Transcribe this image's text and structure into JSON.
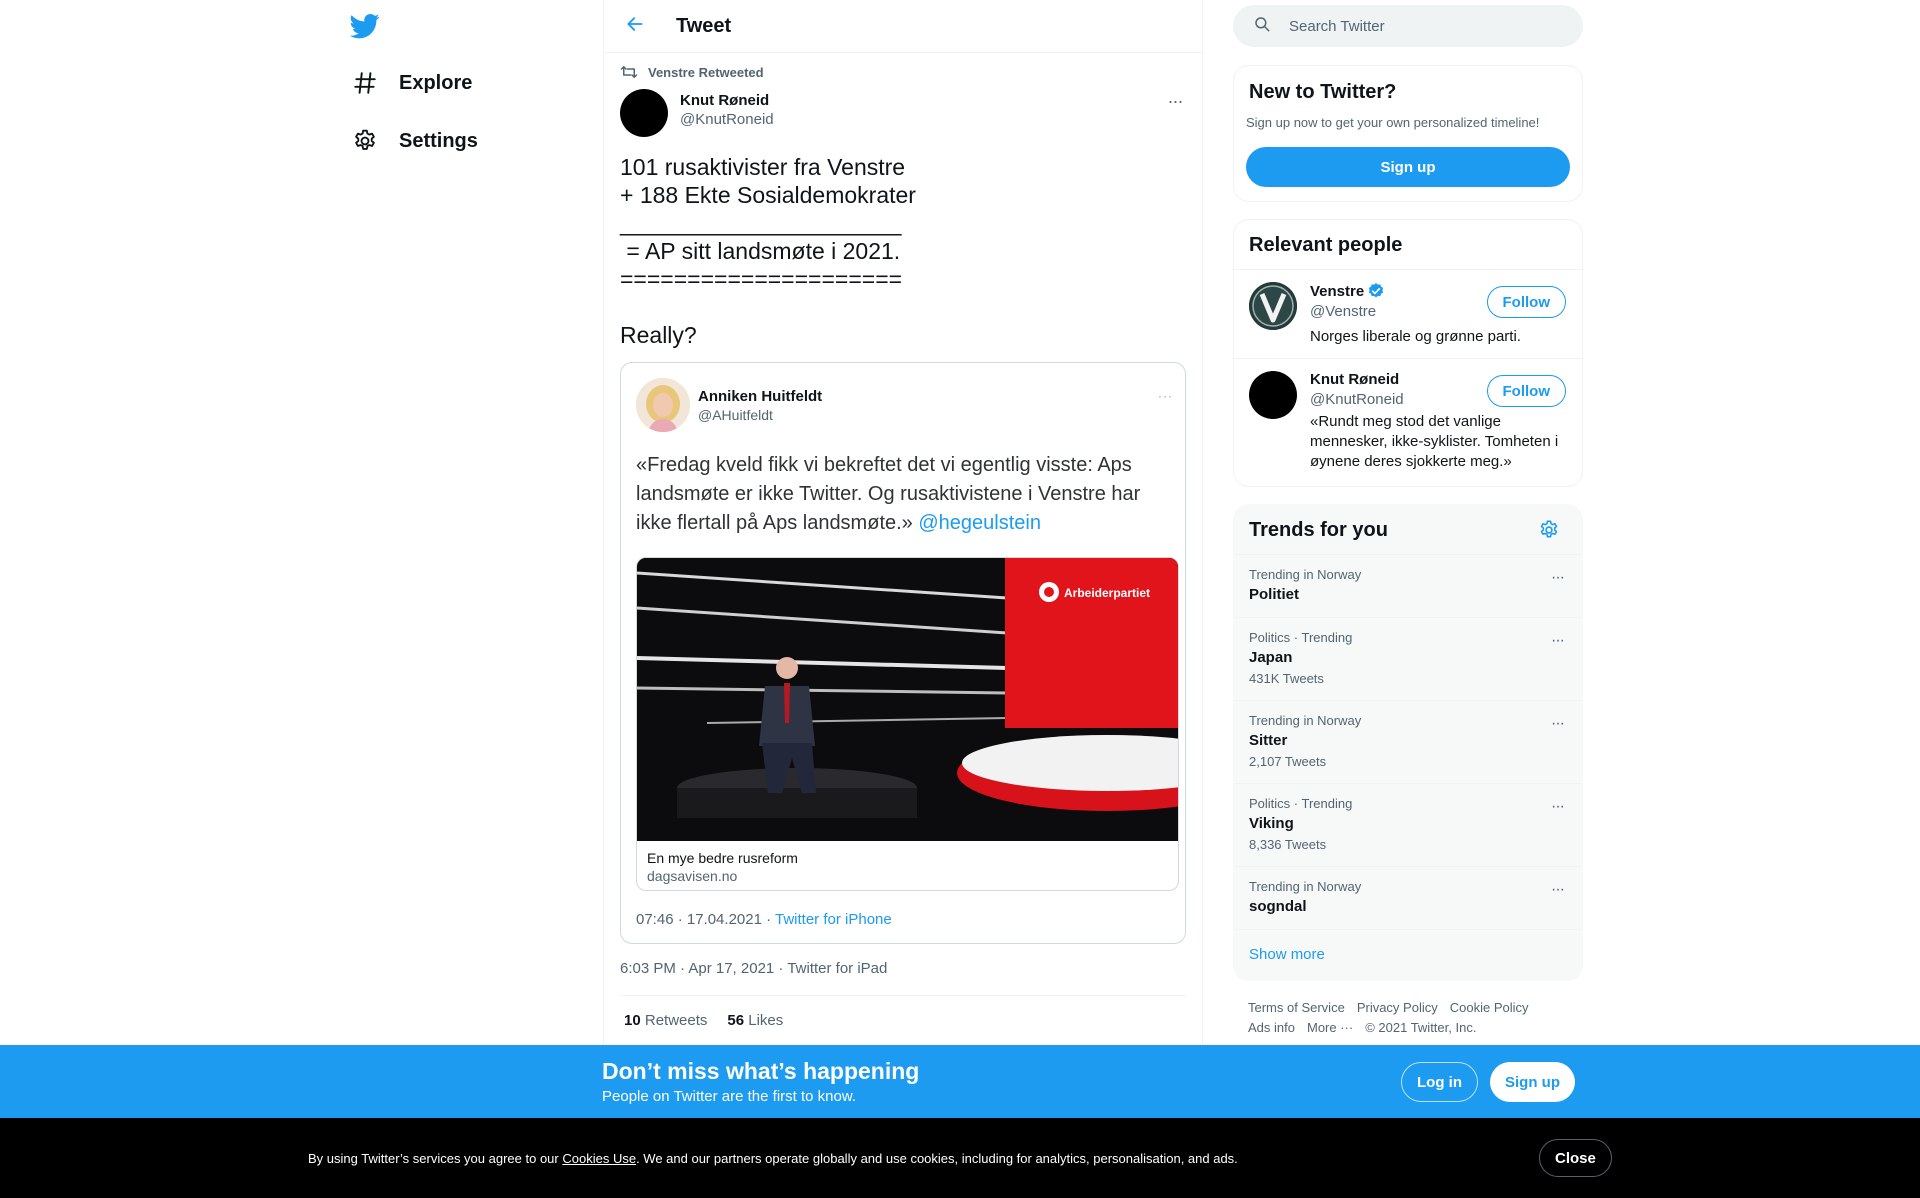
{
  "nav": {
    "logo": "twitter-bird-icon",
    "items": [
      {
        "label": "Explore",
        "icon": "hash-icon"
      },
      {
        "label": "Settings",
        "icon": "gear-icon"
      }
    ]
  },
  "header": {
    "title": "Tweet",
    "back_icon": "arrow-left-icon"
  },
  "tweet": {
    "retweeted_by": "Venstre Retweeted",
    "author_name": "Knut Røneid",
    "author_handle": "@KnutRoneid",
    "text": "101 rusaktivister fra Venstre\n+ 188 Ekte Sosialdemokrater\n______________________\n = AP sitt landsmøte i 2021.\n=====================\n\nReally?",
    "meta": "6:03 PM · Apr 17, 2021 · Twitter for iPad",
    "retweets_count": "10",
    "retweets_label": "Retweets",
    "likes_count": "56",
    "likes_label": "Likes"
  },
  "embedded": {
    "name": "Anniken Huitfeldt",
    "handle": "@AHuitfeldt",
    "text": "«Fredag kveld fikk vi bekreftet det vi egentlig visste: Aps landsmøte er ikke Twitter. Og rusaktivistene i Venstre har ikke flertall på Aps landsmøte.» ",
    "mention": "@hegeulstein",
    "card_brand": "Arbeiderpartiet",
    "card_title": "En mye bedre rusreform",
    "card_domain": "dagsavisen.no",
    "meta": "07:46 · 17.04.2021 · ",
    "meta_source": "Twitter for iPhone"
  },
  "search": {
    "placeholder": "Search Twitter"
  },
  "new_to_twitter": {
    "title": "New to Twitter?",
    "subtitle": "Sign up now to get your own personalized timeline!",
    "button": "Sign up"
  },
  "relevant_people": {
    "title": "Relevant people",
    "people": [
      {
        "name": "Venstre",
        "handle": "@Venstre",
        "bio": "Norges liberale og grønne parti.",
        "button": "Follow",
        "verified": true
      },
      {
        "name": "Knut Røneid",
        "handle": "@KnutRoneid",
        "bio": "«Rundt meg stod det vanlige mennesker, ikke-syklister. Tomheten i øynene deres sjokkerte meg.»",
        "button": "Follow",
        "verified": false
      }
    ]
  },
  "trends": {
    "title": "Trends for you",
    "items": [
      {
        "context": "Trending in Norway",
        "name": "Politiet",
        "count": ""
      },
      {
        "context": "Politics · Trending",
        "name": "Japan",
        "count": "431K Tweets"
      },
      {
        "context": "Trending in Norway",
        "name": "Sitter",
        "count": "2,107 Tweets"
      },
      {
        "context": "Politics · Trending",
        "name": "Viking",
        "count": "8,336 Tweets"
      },
      {
        "context": "Trending in Norway",
        "name": "sogndal",
        "count": ""
      }
    ],
    "show_more": "Show more"
  },
  "footer": {
    "links": [
      "Terms of Service",
      "Privacy Policy",
      "Cookie Policy",
      "Ads info",
      "More ···"
    ],
    "copyright": "© 2021 Twitter, Inc."
  },
  "signup_bar": {
    "headline": "Don’t miss what’s happening",
    "subline": "People on Twitter are the first to know.",
    "login": "Log in",
    "signup": "Sign up"
  },
  "cookie_bar": {
    "text_before": "By using Twitter’s services you agree to our ",
    "link": "Cookies Use",
    "text_after": ". We and our partners operate globally and use cookies, including for analytics, personalisation, and ads.",
    "close": "Close"
  },
  "colors": {
    "accent": "#1d9bf0",
    "text": "#0f1419",
    "muted": "#536471"
  }
}
